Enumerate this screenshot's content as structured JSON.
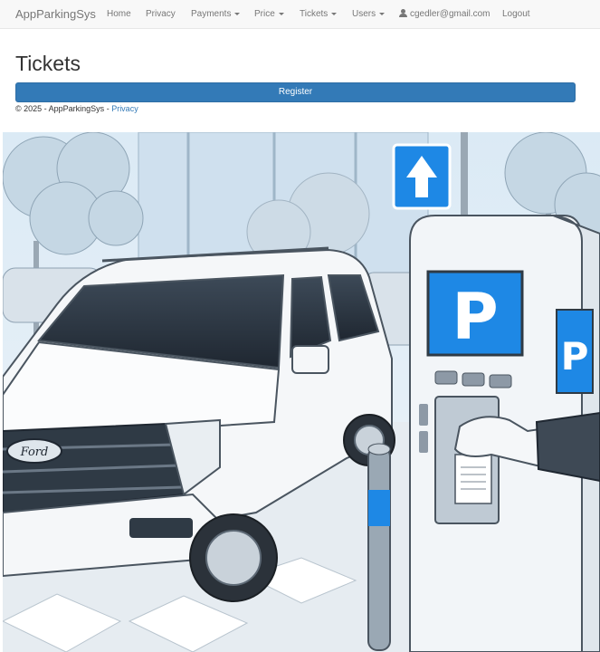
{
  "navbar": {
    "brand": "AppParkingSys",
    "items": [
      {
        "label": "Home",
        "dropdown": false
      },
      {
        "label": "Privacy",
        "dropdown": false
      },
      {
        "label": "Payments",
        "dropdown": true
      },
      {
        "label": "Price",
        "dropdown": true
      },
      {
        "label": "Tickets",
        "dropdown": true
      },
      {
        "label": "Users",
        "dropdown": true
      }
    ],
    "user_email": "cgedler@gmail.com",
    "logout_label": "Logout"
  },
  "main": {
    "title": "Tickets",
    "register_label": "Register"
  },
  "footer": {
    "copyright": "© 2025 - AppParkingSys - ",
    "privacy_link": "Privacy"
  },
  "illustration": {
    "parking_sign_letter": "P",
    "truck_badge": "Ford"
  },
  "colors": {
    "primary": "#337ab7",
    "navbar_bg": "#f8f8f8",
    "sign_blue": "#1e88e5"
  }
}
